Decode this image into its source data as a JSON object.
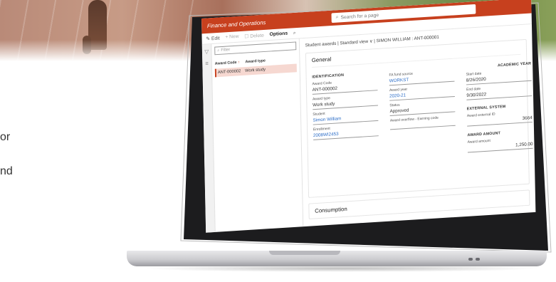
{
  "side_text": {
    "line1": "or",
    "line2": "nd"
  },
  "app": {
    "title": "Finance and Operations",
    "search_placeholder": "Search for a page"
  },
  "actions": {
    "edit": "Edit",
    "new": "New",
    "delete": "Delete",
    "options": "Options"
  },
  "list": {
    "filter_placeholder": "Filter",
    "columns": [
      "Award Code",
      "Award type"
    ],
    "rows": [
      {
        "award_code": "ANT-000002",
        "award_type": "Work study"
      }
    ]
  },
  "detail": {
    "breadcrumb": "Student awards | Standard view ∨ | SIMON WILLIAM : ANT-000001",
    "general_title": "General",
    "identification": {
      "header": "IDENTIFICATION",
      "award_code_label": "Award Code",
      "award_code": "ANT-000002",
      "award_type_label": "Award type",
      "award_type": "Work study",
      "student_label": "Student",
      "student": "Simon William",
      "enrollment_label": "Enrollment",
      "enrollment": "2008WI2453"
    },
    "fund": {
      "fa_fund_source_label": "FA fund source",
      "fa_fund_source": "WORKST",
      "award_year_label": "Award year",
      "award_year": "2020-21",
      "status_label": "Status",
      "status": "Approved",
      "award_overflow_label": "Award overflow - Earning code",
      "award_overflow": ""
    },
    "academic_year": {
      "header": "ACADEMIC YEAR",
      "start_date_label": "Start date",
      "start_date": "8/26/2020",
      "end_date_label": "End date",
      "end_date": "9/30/2022"
    },
    "external_system": {
      "header": "EXTERNAL SYSTEM",
      "award_external_id_label": "Award external ID",
      "award_external_id": "3664"
    },
    "award_amount": {
      "header": "AWARD AMOUNT",
      "award_amount_label": "Award amount",
      "award_amount": "1,250.00"
    },
    "consumption_title": "Consumption"
  },
  "colors": {
    "brand": "#c7401e",
    "selected_row": "#f6d8d1",
    "link": "#2a6cc7"
  },
  "icons": [
    "search-icon",
    "edit-icon",
    "add-icon",
    "delete-icon",
    "filter-icon",
    "hamburger-icon",
    "sort-arrow-icon"
  ]
}
